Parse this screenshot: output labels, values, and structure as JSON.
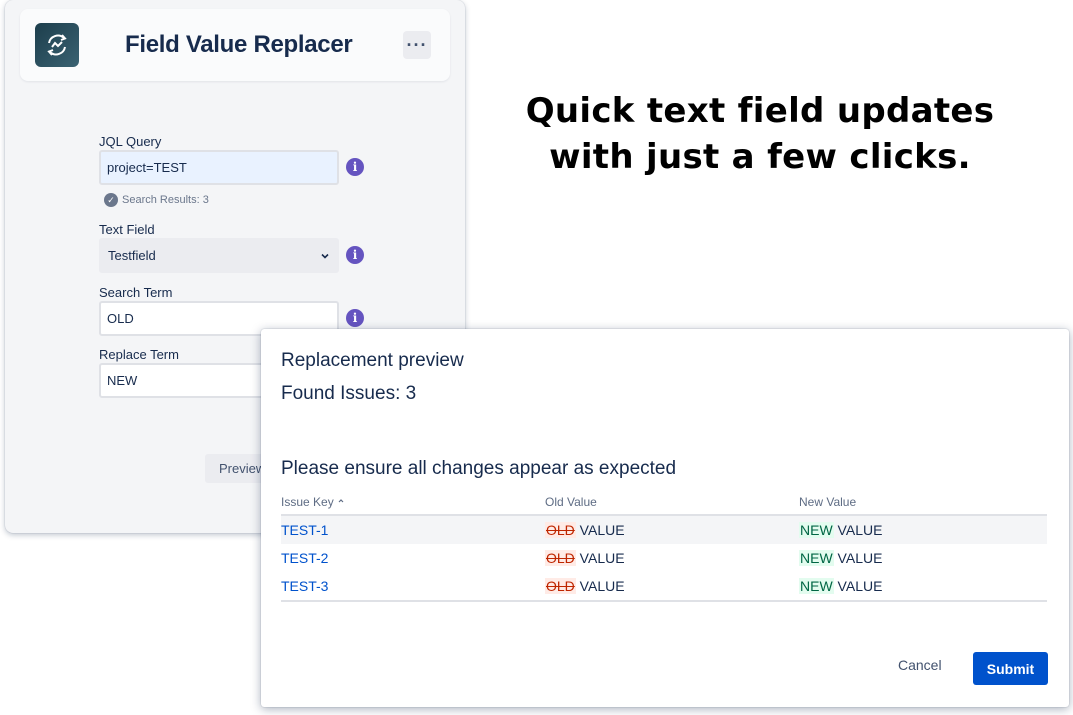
{
  "app": {
    "title": "Field Value Replacer",
    "more_label": "···",
    "logo_icon": "sync-chart-icon"
  },
  "form": {
    "jql_label": "JQL Query",
    "jql_value": "project=TEST",
    "search_results": "Search Results: 3",
    "text_field_label": "Text Field",
    "text_field_value": "Testfield",
    "search_term_label": "Search Term",
    "search_term_value": "OLD",
    "replace_term_label": "Replace Term",
    "replace_term_value": "NEW",
    "info_glyph": "i",
    "preview_label": "Preview"
  },
  "tagline": {
    "line1": "Quick text field updates",
    "line2": "with just a few clicks."
  },
  "modal": {
    "title": "Replacement preview",
    "found_issues": "Found Issues: 3",
    "ensure_text": "Please ensure all changes appear as expected",
    "columns": {
      "issue_key": "Issue Key",
      "old_value": "Old Value",
      "new_value": "New Value"
    },
    "rows": [
      {
        "key": "TEST-1",
        "old_token": "OLD",
        "old_rest": " VALUE",
        "new_token": "NEW",
        "new_rest": " VALUE"
      },
      {
        "key": "TEST-2",
        "old_token": "OLD",
        "old_rest": " VALUE",
        "new_token": "NEW",
        "new_rest": " VALUE"
      },
      {
        "key": "TEST-3",
        "old_token": "OLD",
        "old_rest": " VALUE",
        "new_token": "NEW",
        "new_rest": " VALUE"
      }
    ],
    "cancel_label": "Cancel",
    "submit_label": "Submit"
  },
  "colors": {
    "primary": "#0052cc",
    "info": "#6554c0",
    "removed": "#bf2600",
    "added": "#006644"
  }
}
